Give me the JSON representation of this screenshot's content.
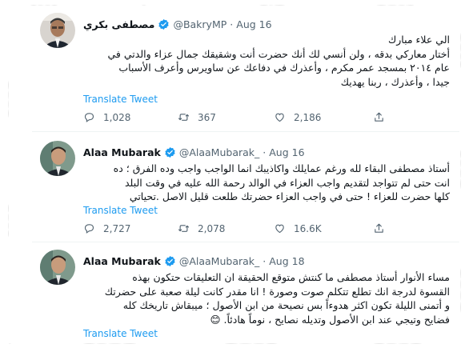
{
  "tweets": [
    {
      "name": "مصطفى بكري",
      "handle": "@BakryMP",
      "date": "Aug 16",
      "lines": [
        "الي علاء مبارك",
        "أختار معاركي بدقه ، ولن أنسي لك أنك حضرت أنت وشقيقك جمال عزاء والدتي في",
        "عام ٢٠١٤ بمسجد عمر مكرم ، وأعذرك في دفاعك عن ساويرس وأعرف الأسباب",
        "جيدا ، وأعذرك ، ربنا يهديك"
      ],
      "translate": "Translate Tweet",
      "replies": "1,028",
      "retweets": "367",
      "likes": "2,186"
    },
    {
      "name": "Alaa Mubarak",
      "handle": "@AlaaMubarak_",
      "date": "Aug 16",
      "lines": [
        "أستاذ مصطفى البقاء لله ورغم عمايلك واكاذيبك انما الواجب واجب وده الفرق ؛ ده",
        "انت حتى لم تتواجد لتقديم واجب العزاء في الوالد رحمة الله عليه في وقت البلد",
        "كلها حضرت للعزاء ! حتى في واجب العزاء حضرتك طلعت قليل الاصل .تحياتي"
      ],
      "translate": "Translate Tweet",
      "replies": "2,727",
      "retweets": "2,078",
      "likes": "16.6K"
    },
    {
      "name": "Alaa Mubarak",
      "handle": "@AlaaMubarak_",
      "date": "Aug 18",
      "lines": [
        "مساء الأنوار أستاذ مصطفى ما كنتش متوقع الحقيقة ان التعليقات حتكون بهذه",
        "القسوة لدرجة انك تطلع تتكلم صوت وصورة ! انا مقدر كانت ليلة صعبة على حضرتك",
        "و أتمنى الليلة تكون اكثر هدوءاً بس نصيحة من ابن الأصول ؛ ميبقاش تاريخك كله",
        "فضايح وتيجي عند ابن الأصول وتديله نصايح ، نوماً هادئاً. 😊"
      ],
      "translate": "Translate Tweet"
    }
  ],
  "colors": {
    "verified": "#1d9bf0",
    "link": "#1d9bf0",
    "muted": "#536471",
    "text": "#0f1419"
  }
}
